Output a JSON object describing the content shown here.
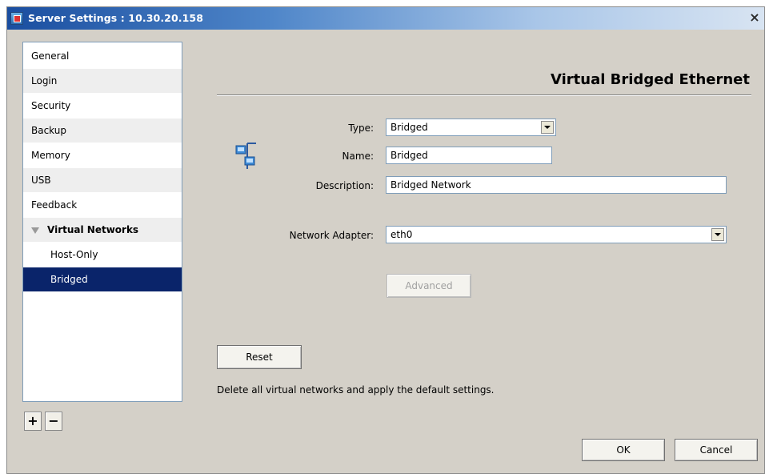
{
  "window": {
    "title": "Server Settings : 10.30.20.158",
    "close_glyph": "×"
  },
  "sidebar": {
    "items": [
      {
        "label": "General"
      },
      {
        "label": "Login"
      },
      {
        "label": "Security"
      },
      {
        "label": "Backup"
      },
      {
        "label": "Memory"
      },
      {
        "label": "USB"
      },
      {
        "label": "Feedback"
      },
      {
        "label": "Virtual Networks",
        "expanded": true
      },
      {
        "label": "Host-Only"
      },
      {
        "label": "Bridged",
        "selected": true
      }
    ],
    "add_label": "+",
    "remove_label": "−"
  },
  "panel": {
    "title": "Virtual Bridged Ethernet",
    "icon": "network-adapter-icon",
    "type_label": "Type:",
    "type_value": "Bridged",
    "name_label": "Name:",
    "name_value": "Bridged",
    "description_label": "Description:",
    "description_value": "Bridged Network",
    "adapter_label": "Network Adapter:",
    "adapter_value": "eth0",
    "advanced_label": "Advanced",
    "reset_label": "Reset",
    "reset_note": "Delete all virtual networks and apply the default settings."
  },
  "footer": {
    "ok_label": "OK",
    "cancel_label": "Cancel"
  },
  "colors": {
    "selection": "#0a246a",
    "dialog_background": "#d4d0c8"
  }
}
